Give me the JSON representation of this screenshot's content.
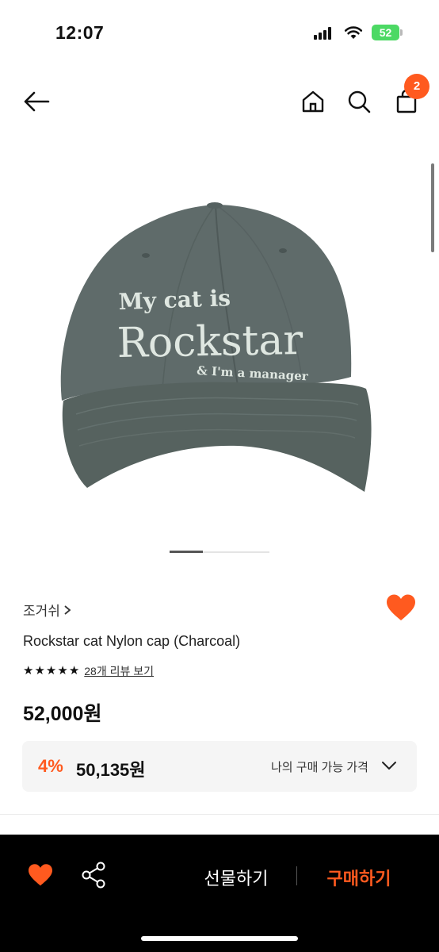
{
  "status_bar": {
    "time": "12:07",
    "battery": "52"
  },
  "header": {
    "cart_count": "2"
  },
  "product": {
    "cap_text_line1": "My cat is",
    "cap_text_line2": "Rockstar",
    "cap_text_line3": "& I'm a manager",
    "brand": "조거쉬",
    "title": "Rockstar cat Nylon cap (Charcoal)",
    "rating_stars": 5,
    "review_link": "28개 리뷰 보기",
    "price": "52,000원",
    "image_page": 1,
    "image_page_count": 3
  },
  "my_price": {
    "discount": "4%",
    "price": "50,135원",
    "label": "나의 구매 가능 가격"
  },
  "bottom_bar": {
    "gift_label": "선물하기",
    "buy_label": "구매하기"
  },
  "colors": {
    "accent": "#ff5a1f",
    "cap": "#5f6b6a",
    "embroidery": "#dfe7e1",
    "battery": "#4cd964"
  }
}
